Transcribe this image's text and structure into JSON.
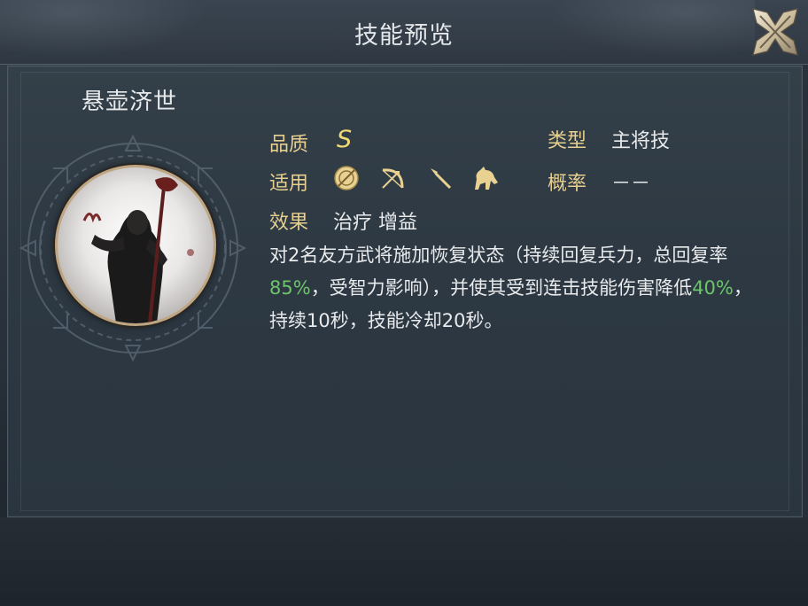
{
  "header": {
    "title": "技能预览"
  },
  "skill": {
    "name": "悬壶济世",
    "quality_label": "品质",
    "quality_value": "S",
    "type_label": "类型",
    "type_value": "主将技",
    "applicable_label": "适用",
    "applicable_icons": [
      "shield-icon",
      "bow-icon",
      "spear-icon",
      "horse-icon"
    ],
    "probability_label": "概率",
    "probability_value": "－－",
    "effect_label": "效果",
    "effect_value": "治疗 增益",
    "description": {
      "p1": "对2名友方武将施加恢复状态（持续回复兵力，总回复率",
      "v1": "85%",
      "p2": "，受智力影响），并使其受到连击技能伤害降低",
      "v2": "40%",
      "p3": "，持续10秒，技能冷却20秒。"
    }
  },
  "colors": {
    "label_gold": "#e6cf8f",
    "grade_gold": "#f1dc74",
    "highlight_green": "#6cc46b",
    "text": "#e8eaec"
  }
}
